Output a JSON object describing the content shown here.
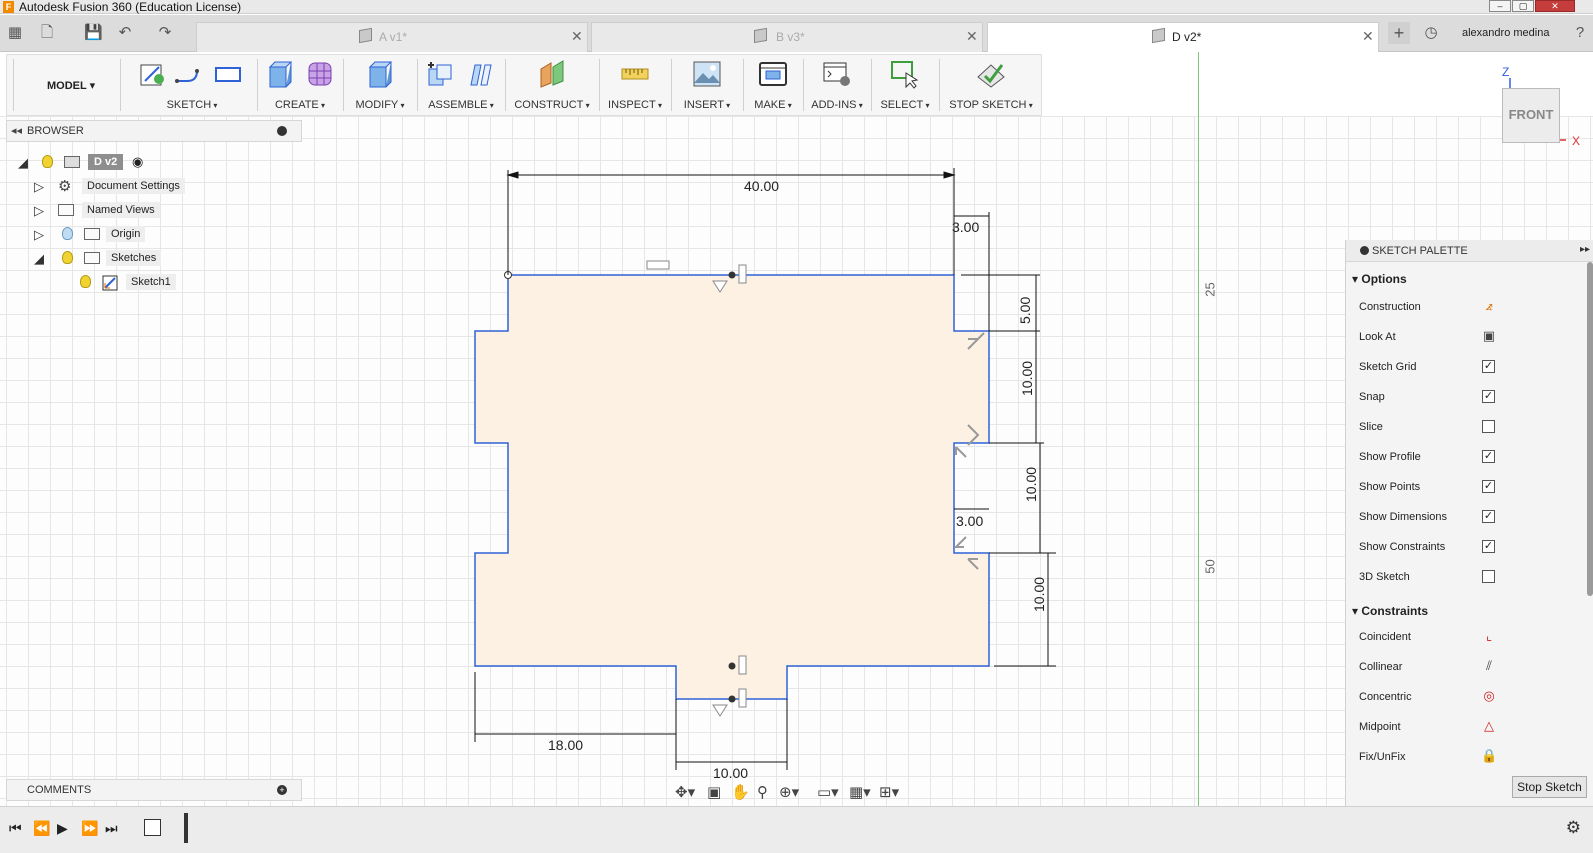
{
  "window": {
    "title": "Autodesk Fusion 360 (Education License)",
    "app_icon_letter": "F"
  },
  "tabs": [
    {
      "label": "A v1*",
      "close": "✕"
    },
    {
      "label": "B v3*",
      "close": "✕"
    },
    {
      "label": "D v2*",
      "close": "✕"
    }
  ],
  "user": {
    "name": "alexandro medina"
  },
  "toolbar": {
    "workspace": "MODEL ▾",
    "groups": [
      "SKETCH",
      "CREATE",
      "MODIFY",
      "ASSEMBLE",
      "CONSTRUCT",
      "INSPECT",
      "INSERT",
      "MAKE",
      "ADD-INS",
      "SELECT",
      "STOP SKETCH"
    ]
  },
  "browser": {
    "title": "BROWSER",
    "root": "D v2",
    "items": [
      {
        "label": "Document Settings"
      },
      {
        "label": "Named Views"
      },
      {
        "label": "Origin"
      },
      {
        "label": "Sketches"
      },
      {
        "label": "Sketch1"
      }
    ]
  },
  "comments": {
    "title": "COMMENTS"
  },
  "viewcube": {
    "face": "FRONT",
    "axis_z": "Z",
    "axis_x": "X"
  },
  "canvas": {
    "ruler_top": "25",
    "ruler_bottom": "50"
  },
  "dimensions": {
    "width_total": "40.00",
    "notch_top_width": "3.00",
    "top_height": "5.00",
    "seg_upper": "10.00",
    "seg_middle": "10.00",
    "notch_mid_width": "3.00",
    "seg_lower": "10.00",
    "bottom_left_offset": "18.00",
    "bottom_tab_width": "10.00"
  },
  "palette": {
    "title": "SKETCH PALETTE",
    "options_title": "Options",
    "options": [
      {
        "label": "Construction",
        "kind": "icon",
        "icon": "construction-icon",
        "glyph": "⦨",
        "color": "#e07000"
      },
      {
        "label": "Look At",
        "kind": "icon",
        "icon": "look-at-icon",
        "glyph": "▣",
        "color": "#444444"
      },
      {
        "label": "Sketch Grid",
        "kind": "check",
        "checked": "✓"
      },
      {
        "label": "Snap",
        "kind": "check",
        "checked": "✓"
      },
      {
        "label": "Slice",
        "kind": "check",
        "checked": ""
      },
      {
        "label": "Show Profile",
        "kind": "check",
        "checked": "✓"
      },
      {
        "label": "Show Points",
        "kind": "check",
        "checked": "✓"
      },
      {
        "label": "Show Dimensions",
        "kind": "check",
        "checked": "✓"
      },
      {
        "label": "Show Constraints",
        "kind": "check",
        "checked": "✓"
      },
      {
        "label": "3D Sketch",
        "kind": "check",
        "checked": ""
      }
    ],
    "constraints_title": "Constraints",
    "constraints": [
      {
        "label": "Coincident",
        "icon": "coincident-icon",
        "glyph": "⌞",
        "color": "#d02020"
      },
      {
        "label": "Collinear",
        "icon": "collinear-icon",
        "glyph": "⫽",
        "color": "#444444"
      },
      {
        "label": "Concentric",
        "icon": "concentric-icon",
        "glyph": "◎",
        "color": "#d02020"
      },
      {
        "label": "Midpoint",
        "icon": "midpoint-icon",
        "glyph": "△",
        "color": "#d02020"
      },
      {
        "label": "Fix/UnFix",
        "icon": "lock-icon",
        "glyph": "🔒",
        "color": "#d02020"
      }
    ],
    "stop_button": "Stop Sketch"
  },
  "colors": {
    "profile_fill": "#fdf1e4",
    "sketch_line": "#2f62d6",
    "dimension_line": "#111111",
    "green_axis": "#7ec87e"
  }
}
